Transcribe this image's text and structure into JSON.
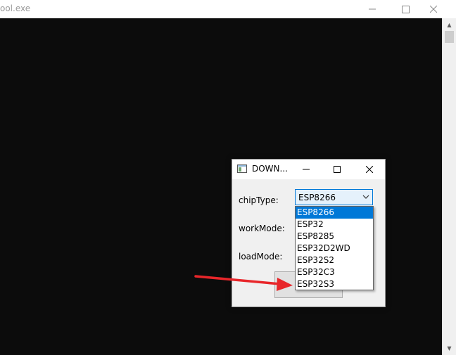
{
  "outer_window": {
    "title": "ool.exe",
    "caption_buttons": {
      "minimize": "minimize-icon",
      "maximize": "maximize-icon",
      "close": "close-icon"
    }
  },
  "dialog": {
    "title": "DOWN...",
    "fields": {
      "chip_type_label": "chipType:",
      "work_mode_label": "workMode:",
      "load_mode_label": "loadMode:"
    },
    "chip_type_value": "ESP8266"
  },
  "dropdown": {
    "options": [
      "ESP8266",
      "ESP32",
      "ESP8285",
      "ESP32D2WD",
      "ESP32S2",
      "ESP32C3",
      "ESP32S3"
    ],
    "selected_index": 0
  },
  "colors": {
    "console_bg": "#0c0c0c",
    "selection": "#0078d7",
    "annotation_arrow": "#e8262a"
  }
}
